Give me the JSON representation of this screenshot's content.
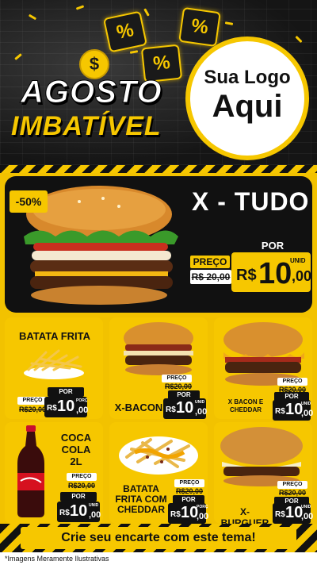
{
  "header": {
    "coin_symbol": "$",
    "percent_symbol": "%",
    "title_line1": "AGOSTO",
    "title_line2": "IMBATÍVEL",
    "logo_line1": "Sua Logo",
    "logo_line2": "Aqui"
  },
  "featured": {
    "name": "X - TUDO",
    "discount": "-50%",
    "por_label": "POR",
    "preco_label": "PREÇO",
    "old_price": "R$ 20,00",
    "currency": "R$",
    "price_int": "10",
    "price_cents": ",00",
    "unit": "UNID"
  },
  "products": [
    {
      "name": "BATATA FRITA",
      "preco_label": "PREÇO",
      "old_price": "R$20,00",
      "por_label": "POR",
      "currency": "R$",
      "price_int": "10",
      "price_cents": ",00",
      "unit": "PORÇ"
    },
    {
      "name": "X-BACON",
      "preco_label": "PREÇO",
      "old_price": "R$20,00",
      "por_label": "POR",
      "currency": "R$",
      "price_int": "10",
      "price_cents": ",00",
      "unit": "UNID"
    },
    {
      "name_line1": "X BACON E",
      "name_line2": "CHEDDAR",
      "preco_label": "PREÇO",
      "old_price": "R$20,00",
      "por_label": "POR",
      "currency": "R$",
      "price_int": "10",
      "price_cents": ",00",
      "unit": "UNID"
    },
    {
      "name_line1": "COCA",
      "name_line2": "COLA",
      "name_line3": "2L",
      "preco_label": "PREÇO",
      "old_price": "R$20,00",
      "por_label": "POR",
      "currency": "R$",
      "price_int": "10",
      "price_cents": ",00",
      "unit": "UNID"
    },
    {
      "name_line1": "BATATA",
      "name_line2": "FRITA COM",
      "name_line3": "CHEDDAR",
      "preco_label": "PREÇO",
      "old_price": "R$20,00",
      "por_label": "POR",
      "currency": "R$",
      "price_int": "10",
      "price_cents": ",00",
      "unit": "PORÇ"
    },
    {
      "name": "X-BURGUER",
      "preco_label": "PREÇO",
      "old_price": "R$20,00",
      "por_label": "POR",
      "currency": "R$",
      "price_int": "10",
      "price_cents": ",00",
      "unit": "UNID"
    }
  ],
  "footer": {
    "banner": "Crie seu encarte com este tema!",
    "disclaimer": "*Imagens Meramente Ilustrativas"
  },
  "colors": {
    "accent": "#f6c700",
    "dark": "#111111"
  }
}
